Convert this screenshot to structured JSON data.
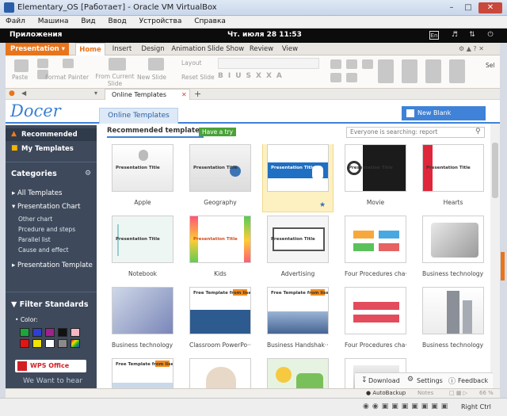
{
  "vbox": {
    "title": "Elementary_OS [Работает] - Oracle VM VirtualBox",
    "menu": [
      "Файл",
      "Машина",
      "Вид",
      "Ввод",
      "Устройства",
      "Справка"
    ],
    "host_key": "Right Ctrl"
  },
  "panel": {
    "apps": "Приложения",
    "clock": "Чт. июля 28   11:53",
    "lang": "En"
  },
  "ribbon": {
    "app_button": "Presentation",
    "tabs": [
      "Home",
      "Insert",
      "Design",
      "Animation",
      "Slide Show",
      "Review",
      "View"
    ],
    "active_tab": "Home",
    "tools": {
      "paste": "Paste",
      "format_painter": "Format Painter",
      "from_current_slide": "From Current Slide",
      "new_slide": "New Slide",
      "layout": "Layout",
      "reset_slide": "Reset Slide",
      "sel": "Sel"
    }
  },
  "doctab": {
    "label": "Online Templates"
  },
  "docer": {
    "logo": "Docer",
    "tab": "Online Templates",
    "new_blank": "New Blank Document",
    "recommended": "Recommended templates",
    "have_a_try": "Have a try",
    "search_placeholder": "Everyone is searching: report"
  },
  "sidebar": {
    "recommended": "Recommended",
    "my_templates": "My Templates",
    "categories": "Categories",
    "all_templates": "All Templates",
    "presentation_chart": "Presentation Chart",
    "sub": [
      "Other chart",
      "Prcedure and steps",
      "Parallel list",
      "Cause and effect"
    ],
    "presentation_template": "Presentation Template",
    "filter": "Filter Standards",
    "color_label": "Color",
    "colors": [
      "#1aa63a",
      "#2e3fd1",
      "#a1208f",
      "#111111",
      "#f4b6c2",
      "#e41414",
      "#f1e300",
      "#ffffff",
      "#8a8a8a",
      "#multi"
    ],
    "wps": "WPS Office",
    "promo": "We Want to hear"
  },
  "templates": [
    {
      "label": "Apple",
      "thumb_text": "Presentation Title",
      "style": "apple"
    },
    {
      "label": "Geography",
      "thumb_text": "Presentation Title",
      "style": "geo"
    },
    {
      "label": "Dentist",
      "thumb_text": "Presentation Title",
      "style": "dentist"
    },
    {
      "label": "Movie",
      "thumb_text": "Presentation Title",
      "style": "movie"
    },
    {
      "label": "Hearts",
      "thumb_text": "Presentation Title",
      "style": "hearts"
    },
    {
      "label": "Notebook",
      "thumb_text": "Presentation Title",
      "style": "notebook"
    },
    {
      "label": "Kids",
      "thumb_text": "Presentation Title",
      "style": "kids"
    },
    {
      "label": "Advertising",
      "thumb_text": "Presentation Title",
      "style": "adv"
    },
    {
      "label": "Four Procedures cha···",
      "thumb_text": "",
      "style": "four"
    },
    {
      "label": "Business technology···",
      "thumb_text": "",
      "style": "biz"
    },
    {
      "label": "Business technology···",
      "thumb_text": "",
      "style": "biz2"
    },
    {
      "label": "Classroom PowerPo···",
      "thumb_text": "Free Template from lisenppt.com",
      "style": "class"
    },
    {
      "label": "Business Handshak···",
      "thumb_text": "Free Template from lisenppt.com",
      "style": "hand"
    },
    {
      "label": "Four Procedures cha···",
      "thumb_text": "",
      "style": "four2"
    },
    {
      "label": "Business technology···",
      "thumb_text": "",
      "style": "tower"
    },
    {
      "label": "",
      "thumb_text": "Free Template from lisenppt.com",
      "style": "r4a"
    },
    {
      "label": "",
      "thumb_text": "",
      "style": "r4b"
    },
    {
      "label": "",
      "thumb_text": "",
      "style": "r4c"
    },
    {
      "label": "",
      "thumb_text": "",
      "style": "r4d"
    }
  ],
  "bottom": {
    "download": "Download",
    "settings": "Settings",
    "feedback": "Feedback"
  },
  "status": {
    "autobackup": "AutoBackup",
    "notes": "Notes",
    "zoom": "66 %"
  }
}
